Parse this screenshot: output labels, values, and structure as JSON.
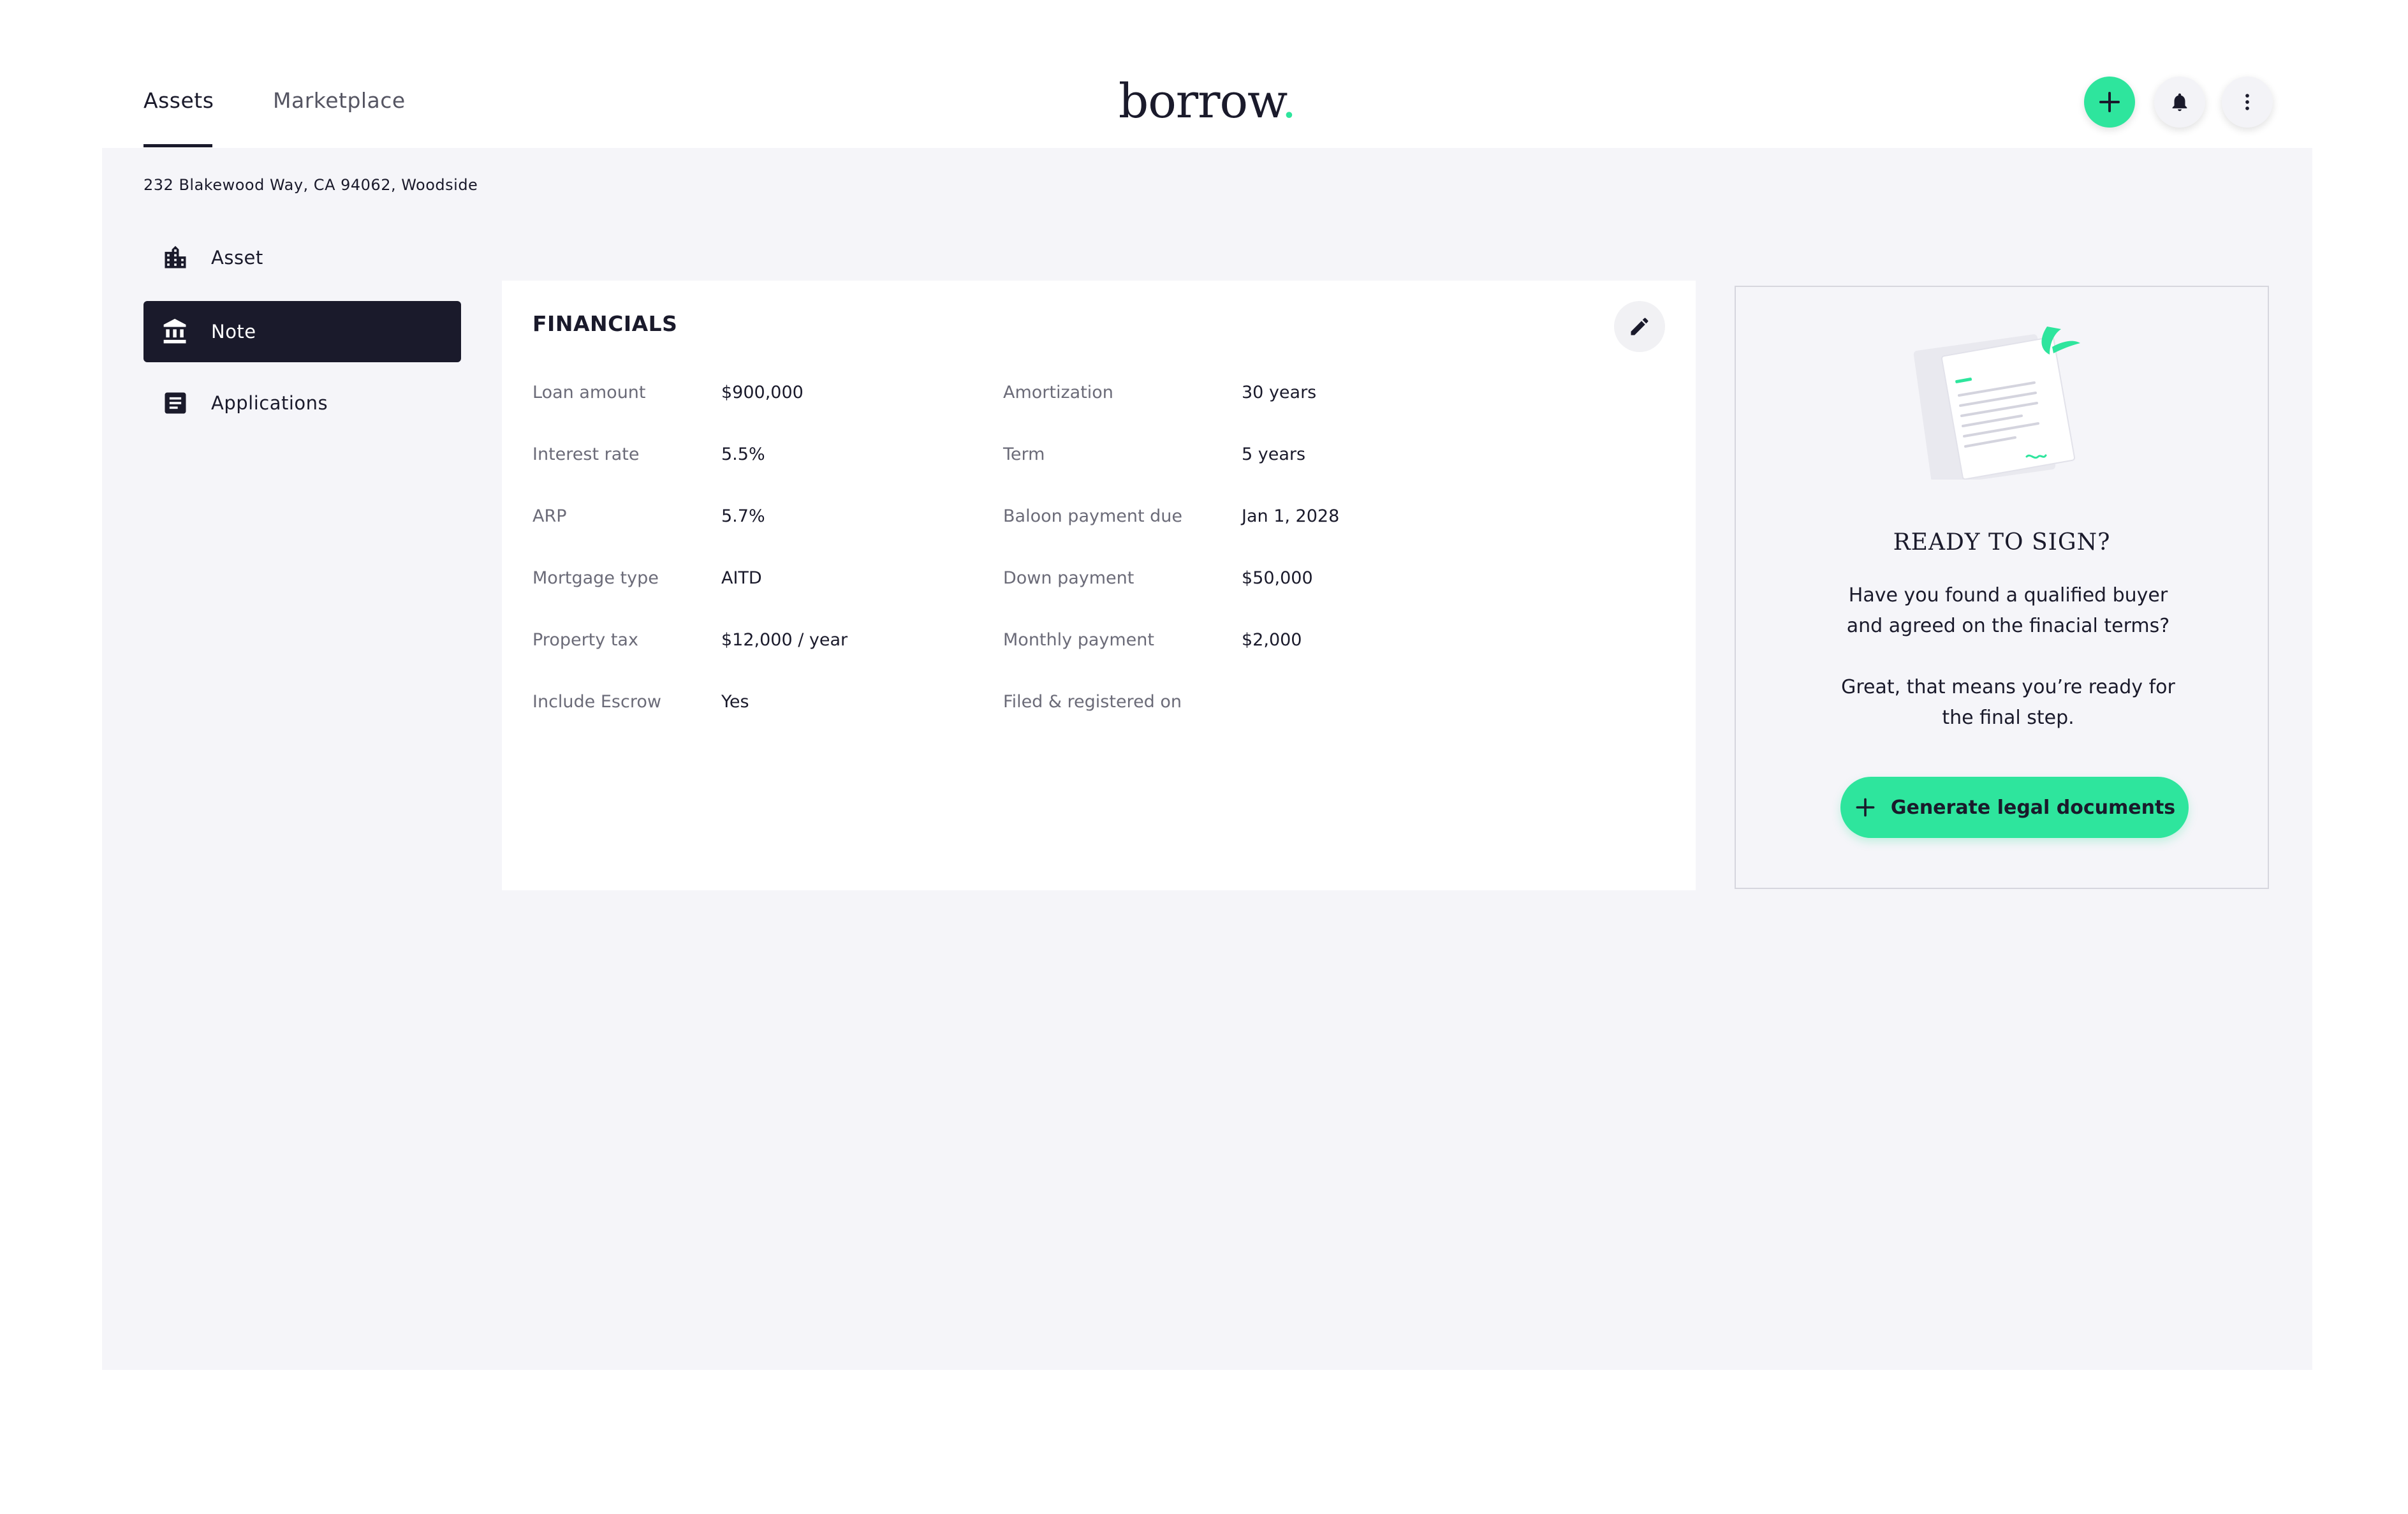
{
  "topbar": {
    "tabs": [
      {
        "label": "Assets",
        "active": true
      },
      {
        "label": "Marketplace",
        "active": false
      }
    ],
    "logo": "borrow",
    "logo_dot": ".",
    "actions": [
      {
        "icon": "plus-icon",
        "color": "#2ee59d"
      },
      {
        "icon": "bell-icon",
        "color": "#f3f3f7"
      },
      {
        "icon": "more-vertical-icon",
        "color": "#f3f3f7"
      }
    ]
  },
  "address": "232 Blakewood Way, CA 94062, Woodside",
  "sidebar": {
    "items": [
      {
        "label": "Asset",
        "icon": "building-icon",
        "active": false
      },
      {
        "label": "Note",
        "icon": "bank-icon",
        "active": true
      },
      {
        "label": "Applications",
        "icon": "document-icon",
        "active": false
      }
    ]
  },
  "financials": {
    "title": "FINANCIALS",
    "left": [
      {
        "label": "Loan amount",
        "value": "$900,000"
      },
      {
        "label": "Interest rate",
        "value": "5.5%"
      },
      {
        "label": "ARP",
        "value": "5.7%"
      },
      {
        "label": "Mortgage type",
        "value": "AITD"
      },
      {
        "label": "Property tax",
        "value": "$12,000 / year"
      },
      {
        "label": "Include Escrow",
        "value": "Yes"
      }
    ],
    "right": [
      {
        "label": "Amortization",
        "value": "30 years"
      },
      {
        "label": "Term",
        "value": "5 years"
      },
      {
        "label": "Baloon payment due",
        "value": "Jan 1, 2028"
      },
      {
        "label": "Down payment",
        "value": "$50,000"
      },
      {
        "label": "Monthly payment",
        "value": "$2,000"
      },
      {
        "label": "Filed & registered on",
        "value": ""
      }
    ]
  },
  "sign": {
    "title": "READY TO SIGN?",
    "line1": "Have you found a qualified buyer",
    "line2": "and agreed on the finacial terms?",
    "line3": "Great, that means you’re ready for",
    "line4": "the final step.",
    "button_label": "Generate legal documents"
  },
  "colors": {
    "accent": "#2ee59d",
    "dark": "#1a1a2b",
    "background": "#f5f5f9"
  }
}
